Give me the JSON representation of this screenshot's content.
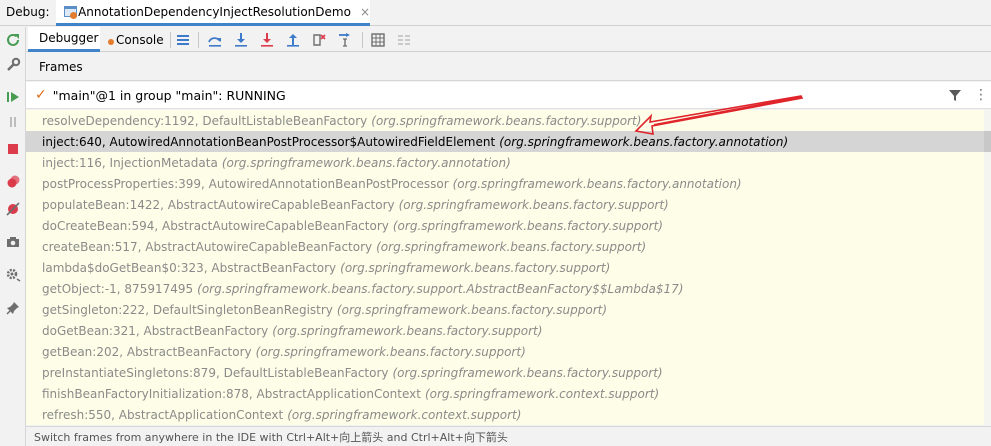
{
  "title_bar": {
    "debug_label": "Debug:",
    "tab": {
      "title": "AnnotationDependencyInjectResolutionDemo",
      "icon": "application-run-config-icon",
      "close": "×"
    }
  },
  "left_toolbar": {
    "icons": [
      "rerun-icon",
      "settings-wrench-icon",
      "resume-icon",
      "pause-icon",
      "stop-icon",
      "view-breakpoints-icon",
      "mute-breakpoints-icon",
      "camera-icon",
      "settings-gear-icon",
      "pin-icon"
    ]
  },
  "toolbar": {
    "tabs": [
      {
        "label": "Debugger",
        "active": true
      },
      {
        "label": "Console",
        "active": false
      }
    ],
    "icons": [
      "menu-icon",
      "show-execution-point-icon",
      "step-over-icon",
      "step-into-icon",
      "force-step-into-icon",
      "step-out-icon",
      "drop-frame-icon",
      "run-to-cursor-icon",
      "evaluate-expression-icon",
      "trace-icon"
    ]
  },
  "frames_panel": {
    "header": "Frames",
    "thread": {
      "label": "\"main\"@1 in group \"main\": RUNNING",
      "status_icon": "check-icon"
    },
    "frames": [
      {
        "method": "resolveDependency:1192, DefaultListableBeanFactory",
        "package": "(org.springframework.beans.factory.support)",
        "selected": false
      },
      {
        "method": "inject:640, AutowiredAnnotationBeanPostProcessor$AutowiredFieldElement",
        "package": "(org.springframework.beans.factory.annotation)",
        "selected": true
      },
      {
        "method": "inject:116, InjectionMetadata",
        "package": "(org.springframework.beans.factory.annotation)",
        "selected": false
      },
      {
        "method": "postProcessProperties:399, AutowiredAnnotationBeanPostProcessor",
        "package": "(org.springframework.beans.factory.annotation)",
        "selected": false
      },
      {
        "method": "populateBean:1422, AbstractAutowireCapableBeanFactory",
        "package": "(org.springframework.beans.factory.support)",
        "selected": false
      },
      {
        "method": "doCreateBean:594, AbstractAutowireCapableBeanFactory",
        "package": "(org.springframework.beans.factory.support)",
        "selected": false
      },
      {
        "method": "createBean:517, AbstractAutowireCapableBeanFactory",
        "package": "(org.springframework.beans.factory.support)",
        "selected": false
      },
      {
        "method": "lambda$doGetBean$0:323, AbstractBeanFactory",
        "package": "(org.springframework.beans.factory.support)",
        "selected": false
      },
      {
        "method": "getObject:-1, 875917495",
        "package": "(org.springframework.beans.factory.support.AbstractBeanFactory$$Lambda$17)",
        "selected": false
      },
      {
        "method": "getSingleton:222, DefaultSingletonBeanRegistry",
        "package": "(org.springframework.beans.factory.support)",
        "selected": false
      },
      {
        "method": "doGetBean:321, AbstractBeanFactory",
        "package": "(org.springframework.beans.factory.support)",
        "selected": false
      },
      {
        "method": "getBean:202, AbstractBeanFactory",
        "package": "(org.springframework.beans.factory.support)",
        "selected": false
      },
      {
        "method": "preInstantiateSingletons:879, DefaultListableBeanFactory",
        "package": "(org.springframework.beans.factory.support)",
        "selected": false
      },
      {
        "method": "finishBeanFactoryInitialization:878, AbstractApplicationContext",
        "package": "(org.springframework.context.support)",
        "selected": false
      },
      {
        "method": "refresh:550, AbstractApplicationContext",
        "package": "(org.springframework.context.support)",
        "selected": false
      }
    ]
  },
  "status_bar": {
    "text": "Switch frames from anywhere in the IDE with Ctrl+Alt+向上箭头 and Ctrl+Alt+向下箭头"
  },
  "colors": {
    "accent": "#4083c9",
    "frames_background": "#fefee8",
    "selected_row": "#d5d5d5",
    "annotation_arrow": "#e0242b"
  }
}
